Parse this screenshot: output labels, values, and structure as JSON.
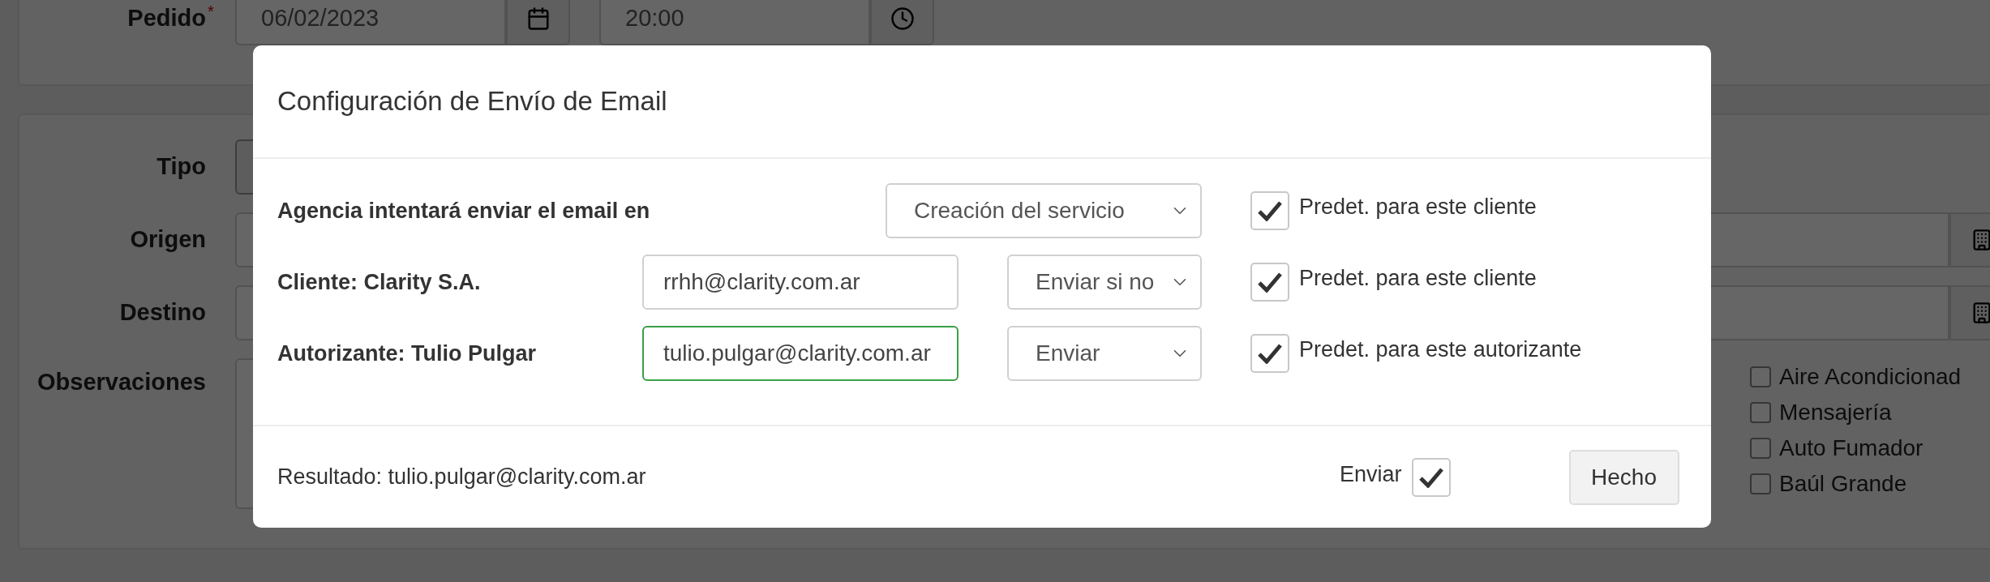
{
  "page": {
    "order": {
      "label": "Pedido",
      "required_mark": "*",
      "date": "06/02/2023",
      "time": "20:00"
    },
    "fields": [
      {
        "label": "Tipo",
        "kind": "select"
      },
      {
        "label": "Origen",
        "kind": "address"
      },
      {
        "label": "Destino",
        "kind": "address"
      },
      {
        "label": "Observaciones",
        "kind": "textarea"
      }
    ],
    "options": [
      {
        "label": "Aire Acondicionad",
        "checked": false
      },
      {
        "label": "Mensajería",
        "checked": false
      },
      {
        "label": "Auto Fumador",
        "checked": false
      },
      {
        "label": "Baúl Grande",
        "checked": false
      }
    ]
  },
  "modal": {
    "title": "Configuración de Envío de Email",
    "rows": [
      {
        "kind": "agency",
        "label": "Agencia intentará enviar el email en",
        "select": "Creación del servicio",
        "default_checked": true,
        "default_label": "Predet. para este cliente"
      },
      {
        "kind": "contact",
        "label": "Cliente: Clarity S.A.",
        "email": "rrhh@clarity.com.ar",
        "focused": false,
        "select": "Enviar si no",
        "default_checked": true,
        "default_label": "Predet. para este cliente"
      },
      {
        "kind": "contact",
        "label": "Autorizante: Tulio Pulgar",
        "email": "tulio.pulgar@clarity.com.ar",
        "focused": true,
        "select": "Enviar",
        "default_checked": true,
        "default_label": "Predet. para este autorizante"
      }
    ],
    "result": "Resultado: tulio.pulgar@clarity.com.ar",
    "send": {
      "label": "Enviar",
      "checked": true
    },
    "done_button": "Hecho"
  }
}
